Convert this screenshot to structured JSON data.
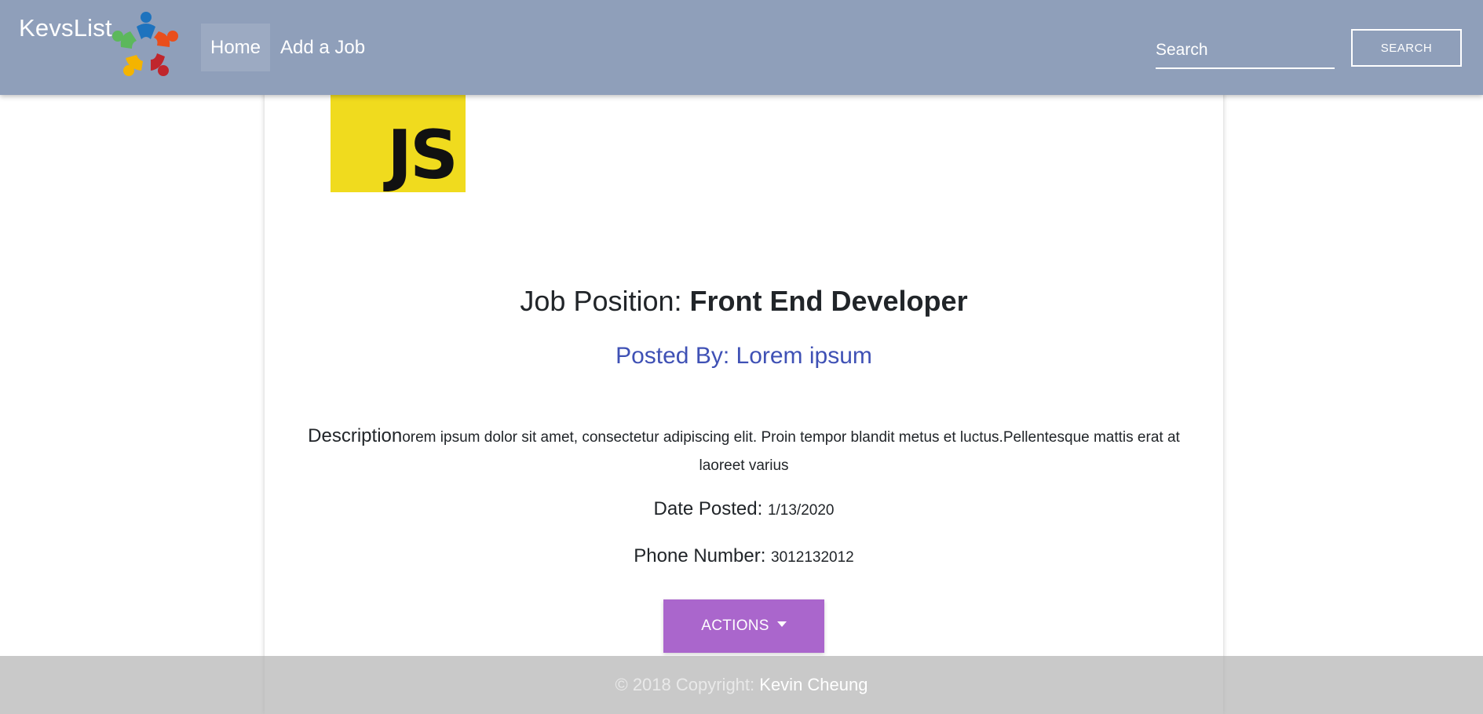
{
  "navbar": {
    "brand": "KevsList",
    "brand_logo_icon": "people-circle-logo-icon",
    "items": [
      {
        "label": "Home",
        "active": true
      },
      {
        "label": "Add a Job",
        "active": false
      }
    ],
    "search_placeholder": "Search",
    "search_button_label": "SEARCH",
    "background_color": "#8f9fba"
  },
  "job": {
    "logo_text": "JS",
    "logo_color": "#f0db1e",
    "title_label": "Job Position: ",
    "title_value": "Front End Developer",
    "posted_by": "Posted By: Lorem ipsum",
    "posted_by_color": "#3f51b5",
    "description_label": "Description",
    "description_value": "orem ipsum dolor sit amet, consectetur adipiscing elit. Proin tempor blandit metus et luctus.Pellentesque mattis erat at laoreet varius",
    "date_label": "Date Posted: ",
    "date_value": "1/13/2020",
    "phone_label": "Phone Number: ",
    "phone_value": "3012132012",
    "actions_label": "ACTIONS",
    "actions_color": "#aa66cc"
  },
  "footer": {
    "copyright": "© 2018 Copyright: ",
    "author": "Kevin Cheung"
  }
}
